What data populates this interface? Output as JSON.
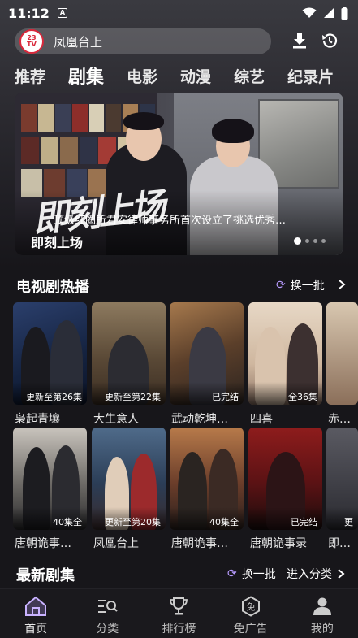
{
  "status_bar": {
    "time": "11:12",
    "notif_glyph": "A"
  },
  "search": {
    "placeholder": "凤凰台上",
    "logo_top": "23",
    "logo_bottom": "TV"
  },
  "tabs": [
    {
      "label": "推荐"
    },
    {
      "label": "剧集"
    },
    {
      "label": "电影"
    },
    {
      "label": "动漫"
    },
    {
      "label": "综艺"
    },
    {
      "label": "纪录片"
    }
  ],
  "banner": {
    "calligraphy": "即刻上场",
    "description": "顶级红圈所君安律师事务所首次设立了挑选优秀…",
    "title": "即刻上场"
  },
  "hot_section": {
    "title": "电视剧热播",
    "refresh_label": "换一批"
  },
  "hot_row1": [
    {
      "title": "枭起青壤",
      "badge": "更新至第26集"
    },
    {
      "title": "大生意人",
      "badge": "更新至第22集"
    },
    {
      "title": "武动乾坤…",
      "badge": "已完结"
    },
    {
      "title": "四喜",
      "badge": "全36集"
    },
    {
      "title": "赤…",
      "badge": ""
    }
  ],
  "hot_row2": [
    {
      "title": "唐朝诡事…",
      "badge": "40集全"
    },
    {
      "title": "凤凰台上",
      "badge": "更新至第20集"
    },
    {
      "title": "唐朝诡事…",
      "badge": "40集全"
    },
    {
      "title": "唐朝诡事录",
      "badge": "已完结"
    },
    {
      "title": "即…",
      "badge": "更"
    }
  ],
  "latest_section": {
    "title": "最新剧集",
    "refresh_label": "换一批",
    "category_label": "进入分类"
  },
  "nav": [
    {
      "label": "首页",
      "icon": "home-icon"
    },
    {
      "label": "分类",
      "icon": "category-search-icon"
    },
    {
      "label": "排行榜",
      "icon": "trophy-icon"
    },
    {
      "label": "免广告",
      "icon": "no-ads-icon"
    },
    {
      "label": "我的",
      "icon": "profile-icon"
    }
  ],
  "colors": {
    "accent": "#b89bff",
    "background": "#17161a",
    "logo_red": "#d9273a"
  }
}
